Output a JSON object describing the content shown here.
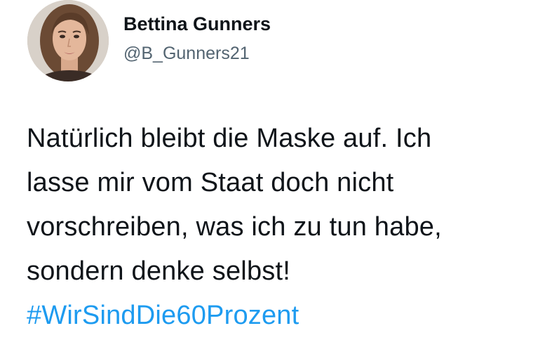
{
  "author": {
    "display_name": "Bettina Gunners",
    "handle": "@B_Gunners21",
    "avatar_icon": "profile-photo"
  },
  "tweet": {
    "lines": [
      "Natürlich bleibt die Maske auf. Ich",
      "lasse mir vom Staat doch nicht",
      "vorschreiben, was ich zu tun habe,",
      "sondern denke selbst!"
    ],
    "hashtag": "#WirSindDie60Prozent"
  },
  "colors": {
    "text": "#0f1419",
    "secondary_text": "#536471",
    "link": "#1d9bf0",
    "background": "#ffffff"
  }
}
